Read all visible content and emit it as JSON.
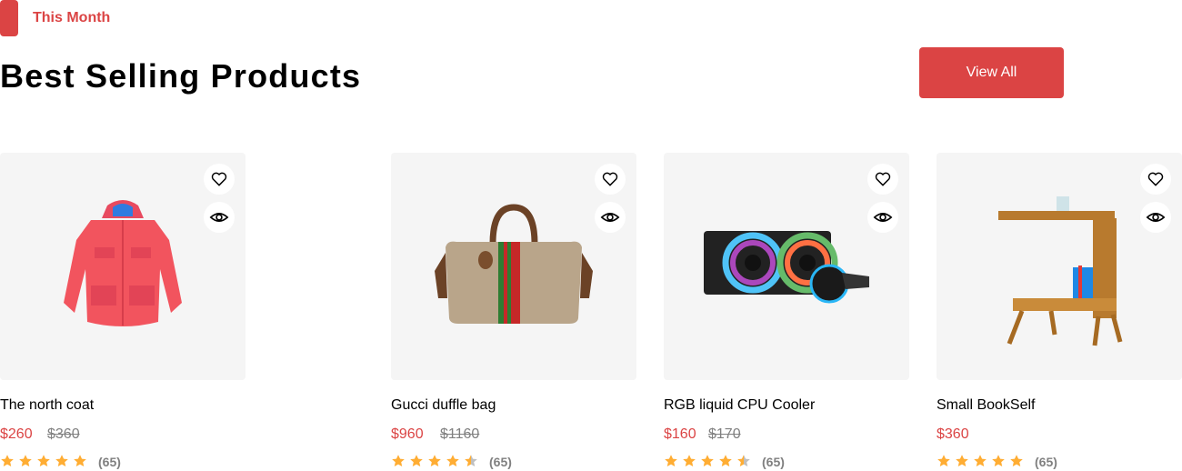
{
  "section": {
    "tag": "This Month",
    "title": "Best Selling Products",
    "view_all_label": "View All"
  },
  "colors": {
    "accent": "#DB4444",
    "star": "#FFAD33",
    "star_empty": "#BFBFBF",
    "muted": "#808080",
    "card_bg": "#F5F5F5"
  },
  "products": [
    {
      "name": "The north coat",
      "price": "$260",
      "old_price": "$360",
      "rating": 5,
      "reviews": "(65)",
      "image": "red-coat"
    },
    {
      "name": "Gucci duffle bag",
      "price": "$960",
      "old_price": "$1160",
      "rating": 4.5,
      "reviews": "(65)",
      "image": "duffle-bag"
    },
    {
      "name": "RGB liquid CPU Cooler",
      "price": "$160",
      "old_price": "$170",
      "rating": 4.5,
      "reviews": "(65)",
      "image": "cpu-cooler"
    },
    {
      "name": "Small BookSelf",
      "price": "$360",
      "old_price": "",
      "rating": 5,
      "reviews": "(65)",
      "image": "bookshelf"
    }
  ]
}
